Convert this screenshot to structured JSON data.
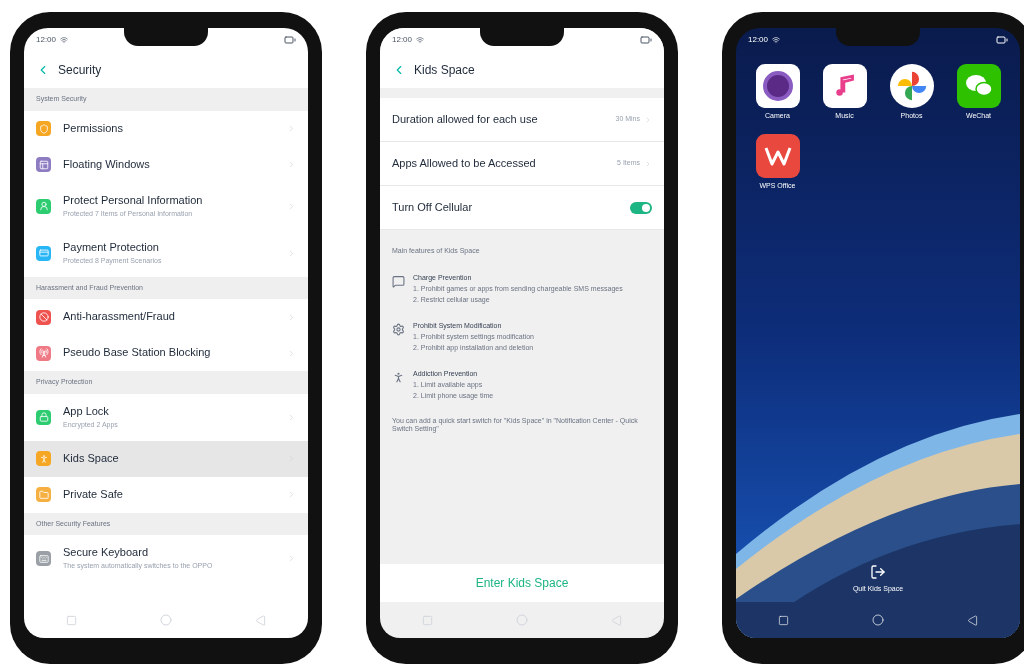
{
  "phones": [
    {
      "kind": "settings",
      "status_time": "12:00",
      "title": "Security",
      "sections": [
        {
          "heading": "System Security",
          "items": [
            {
              "label": "Permissions",
              "color": "#f5a623",
              "selected": false
            },
            {
              "label": "Floating Windows",
              "color": "#8e7cc3",
              "selected": false
            },
            {
              "label": "Protect Personal Information",
              "subtitle": "Protected 7 Items of Personal Information",
              "color": "#2ecc71",
              "selected": false
            },
            {
              "label": "Payment Protection",
              "subtitle": "Protected 8 Payment Scenarios",
              "color": "#29b6f6",
              "selected": false
            }
          ]
        },
        {
          "heading": "Harassment and Fraud Prevention",
          "items": [
            {
              "label": "Anti-harassment/Fraud",
              "color": "#ef5350",
              "selected": false
            },
            {
              "label": "Pseudo Base Station Blocking",
              "color": "#ef7a85",
              "selected": false
            }
          ]
        },
        {
          "heading": "Privacy Protection",
          "items": [
            {
              "label": "App Lock",
              "subtitle": "Encrypted 2 Apps",
              "color": "#2ecc71",
              "selected": false
            },
            {
              "label": "Kids Space",
              "color": "#f5a623",
              "selected": true
            },
            {
              "label": "Private Safe",
              "color": "#f5b041",
              "selected": false
            }
          ]
        },
        {
          "heading": "Other Security Features",
          "items": [
            {
              "label": "Secure Keyboard",
              "subtitle": "The system automatically switches to the OPPO",
              "color": "#9aa0a6",
              "selected": false
            }
          ]
        }
      ]
    },
    {
      "kind": "kids_space",
      "status_time": "12:00",
      "title": "Kids Space",
      "settings": [
        {
          "kind": "link",
          "label": "Duration allowed for each use",
          "value": "30 Mins"
        },
        {
          "kind": "link",
          "label": "Apps Allowed to be Accessed",
          "value": "5 Items"
        },
        {
          "kind": "toggle",
          "label": "Turn Off Cellular",
          "on": true
        }
      ],
      "features_heading": "Main features of Kids Space",
      "features": [
        {
          "title": "Charge Prevention",
          "lines": [
            "1. Prohibit games or apps from sending chargeable SMS messages",
            "2. Restrict cellular usage"
          ]
        },
        {
          "title": "Prohibit System Modification",
          "lines": [
            "1. Prohibit system settings modification",
            "2. Prohibit app installation and deletion"
          ]
        },
        {
          "title": "Addiction Prevention",
          "lines": [
            "1. Limit available apps",
            "2. Limit phone usage time"
          ]
        }
      ],
      "note": "You can add a quick start switch for \"Kids Space\" in \"Notification Center - Quick Switch Setting\"",
      "action": "Enter Kids Space"
    },
    {
      "kind": "home",
      "status_time": "12:00",
      "apps": [
        {
          "label": "Camera"
        },
        {
          "label": "Music"
        },
        {
          "label": "Photos"
        },
        {
          "label": "WeChat"
        },
        {
          "label": "WPS Office"
        }
      ],
      "quit": "Quit Kids Space"
    }
  ]
}
